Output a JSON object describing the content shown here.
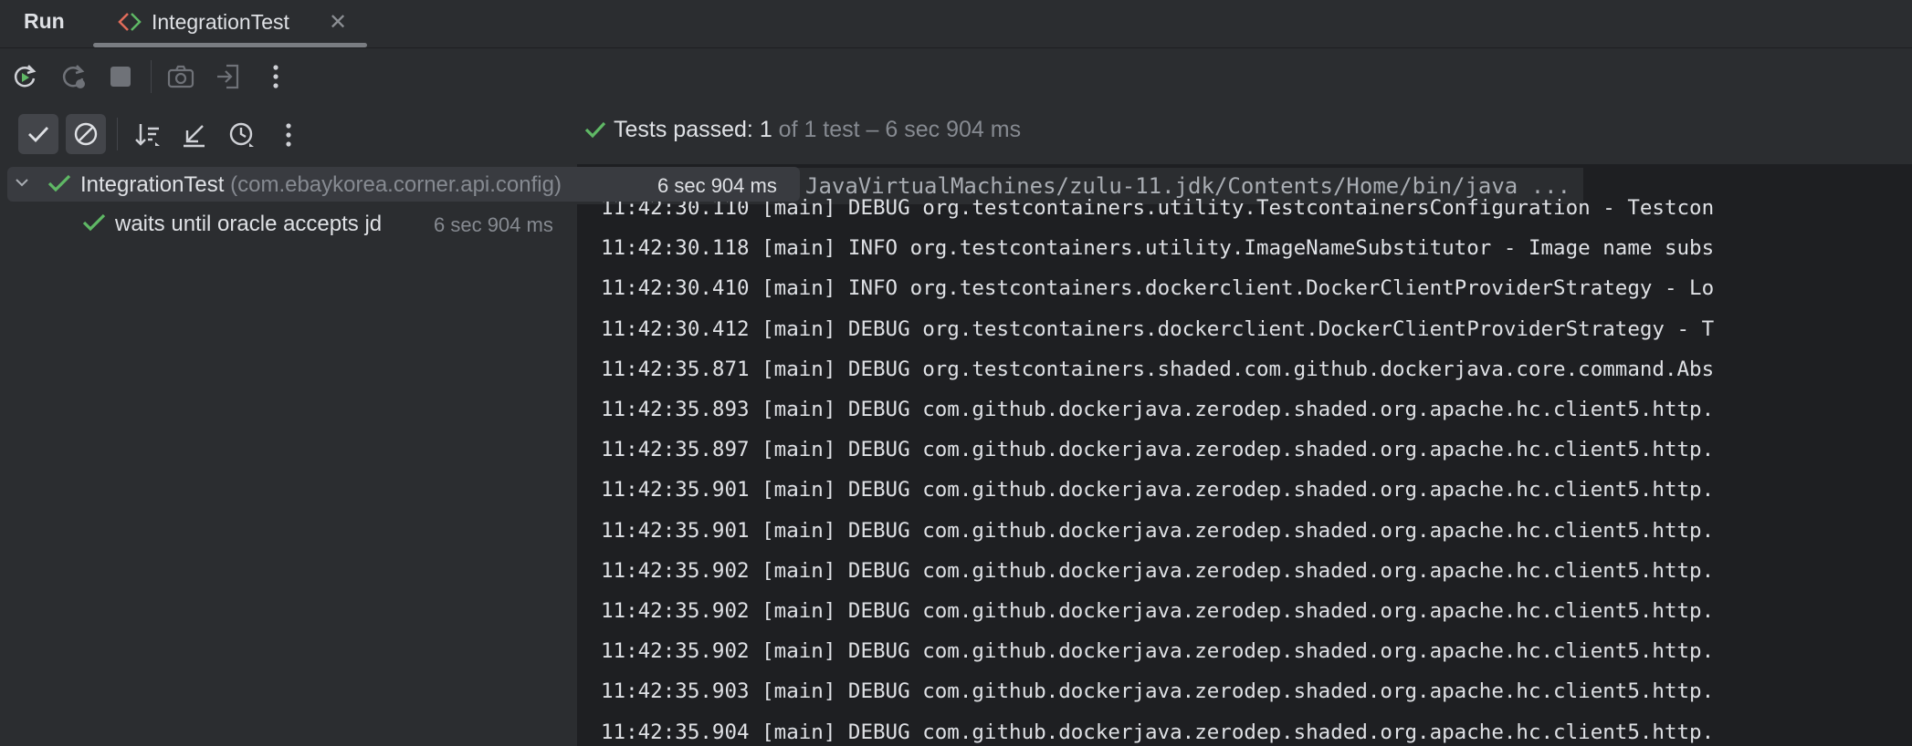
{
  "tabbar": {
    "run_label": "Run",
    "tab": {
      "label": "IntegrationTest",
      "close": "✕"
    }
  },
  "status": {
    "passed_label": "Tests passed:",
    "passed_count": "1",
    "detail": " of 1 test – 6 sec 904 ms"
  },
  "tree": {
    "root": {
      "name": "IntegrationTest",
      "package": " (com.ebaykorea.corner.api.config)",
      "time": "6 sec 904 ms"
    },
    "child": {
      "name": "waits until oracle accepts jd",
      "time": "6 sec 904 ms"
    }
  },
  "console": {
    "header": "JavaVirtualMachines/zulu-11.jdk/Contents/Home/bin/java ...",
    "lines": [
      "11:42:30.110 [main] DEBUG org.testcontainers.utility.TestcontainersConfiguration - Testcon",
      "11:42:30.118 [main] INFO org.testcontainers.utility.ImageNameSubstitutor - Image name subs",
      "11:42:30.410 [main] INFO org.testcontainers.dockerclient.DockerClientProviderStrategy - Lo",
      "11:42:30.412 [main] DEBUG org.testcontainers.dockerclient.DockerClientProviderStrategy - T",
      "11:42:35.871 [main] DEBUG org.testcontainers.shaded.com.github.dockerjava.core.command.Abs",
      "11:42:35.893 [main] DEBUG com.github.dockerjava.zerodep.shaded.org.apache.hc.client5.http.",
      "11:42:35.897 [main] DEBUG com.github.dockerjava.zerodep.shaded.org.apache.hc.client5.http.",
      "11:42:35.901 [main] DEBUG com.github.dockerjava.zerodep.shaded.org.apache.hc.client5.http.",
      "11:42:35.901 [main] DEBUG com.github.dockerjava.zerodep.shaded.org.apache.hc.client5.http.",
      "11:42:35.902 [main] DEBUG com.github.dockerjava.zerodep.shaded.org.apache.hc.client5.http.",
      "11:42:35.902 [main] DEBUG com.github.dockerjava.zerodep.shaded.org.apache.hc.client5.http.",
      "11:42:35.902 [main] DEBUG com.github.dockerjava.zerodep.shaded.org.apache.hc.client5.http.",
      "11:42:35.903 [main] DEBUG com.github.dockerjava.zerodep.shaded.org.apache.hc.client5.http.",
      "11:42:35.904 [main] DEBUG com.github.dockerjava.zerodep.shaded.org.apache.hc.client5.http."
    ]
  },
  "icons": {
    "rerun": "rerun-icon",
    "rerun_failed": "rerun-failed-icon",
    "stop": "stop-icon",
    "screenshot": "camera-icon",
    "exit": "exit-icon",
    "more": "more-vertical-icon",
    "show_passed": "check-icon",
    "show_ignored": "ignored-icon",
    "sort": "sort-icon",
    "collapse": "collapse-icon",
    "history": "history-icon"
  },
  "colors": {
    "pass_green": "#5fb865",
    "background": "#1e1f22",
    "panel": "#2b2d30"
  }
}
